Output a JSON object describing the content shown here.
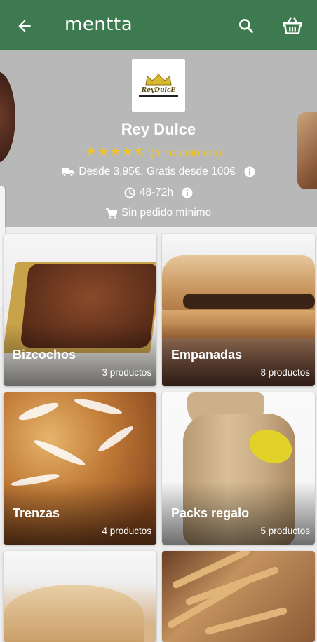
{
  "topbar": {
    "logo_text": "mentta"
  },
  "store": {
    "brand_logo_text": "ReyDulcE",
    "name": "Rey Dulce",
    "stars": "★★★★⯪",
    "rating_value": 4.5,
    "reviews": "(57 opiniones)",
    "shipping": "Desde 3,95€. Gratis desde 100€",
    "delivery_time": "48-72h",
    "min_order": "Sin pedido mínimo"
  },
  "categories": [
    {
      "title": "Bizcochos",
      "count": "3 productos"
    },
    {
      "title": "Empanadas",
      "count": "8 productos"
    },
    {
      "title": "Trenzas",
      "count": "4 productos"
    },
    {
      "title": "Packs regalo",
      "count": "5 productos"
    }
  ],
  "colors": {
    "header": "#3d7a4f",
    "hero": "#b8b8b8",
    "star": "#f5c518"
  }
}
